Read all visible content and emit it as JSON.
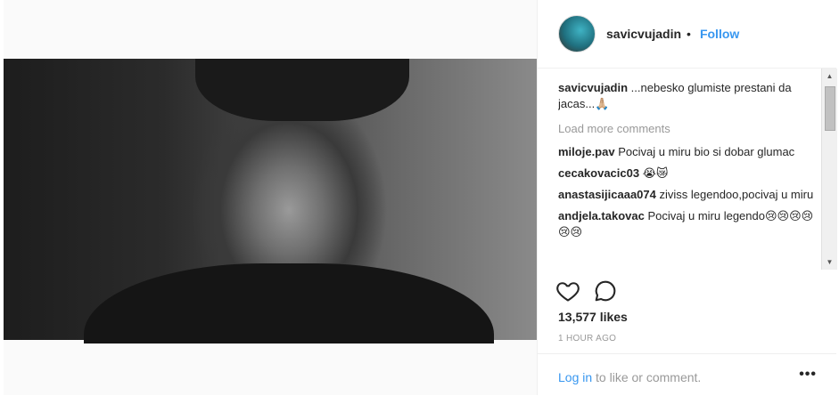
{
  "post": {
    "username": "savicvujadin",
    "follow_label": "Follow",
    "separator": "•"
  },
  "caption": {
    "username": "savicvujadin",
    "text": "...nebesko glumiste prestani da jacas...🙏🏼"
  },
  "load_more": "Load more comments",
  "comments": [
    {
      "user": "miloje.pav",
      "text": "Pocivaj u miru bio si dobar glumac"
    },
    {
      "user": "cecakovacic03",
      "text": "😭😿"
    },
    {
      "user": "anastasijicaaa074",
      "text": "ziviss legendoo,pocivaj u miru"
    },
    {
      "user": "andjela.takovac",
      "text": "Pocivaj u miru legendo😢😢😢😢😢😢"
    }
  ],
  "likes": "13,577 likes",
  "time": "1 HOUR AGO",
  "footer": {
    "login": "Log in",
    "rest": " to like or comment."
  },
  "icons": {
    "like": "heart-icon",
    "comment": "comment-bubble-icon",
    "options": "more-options-icon"
  },
  "colors": {
    "link": "#3897f0",
    "muted": "#999999"
  }
}
